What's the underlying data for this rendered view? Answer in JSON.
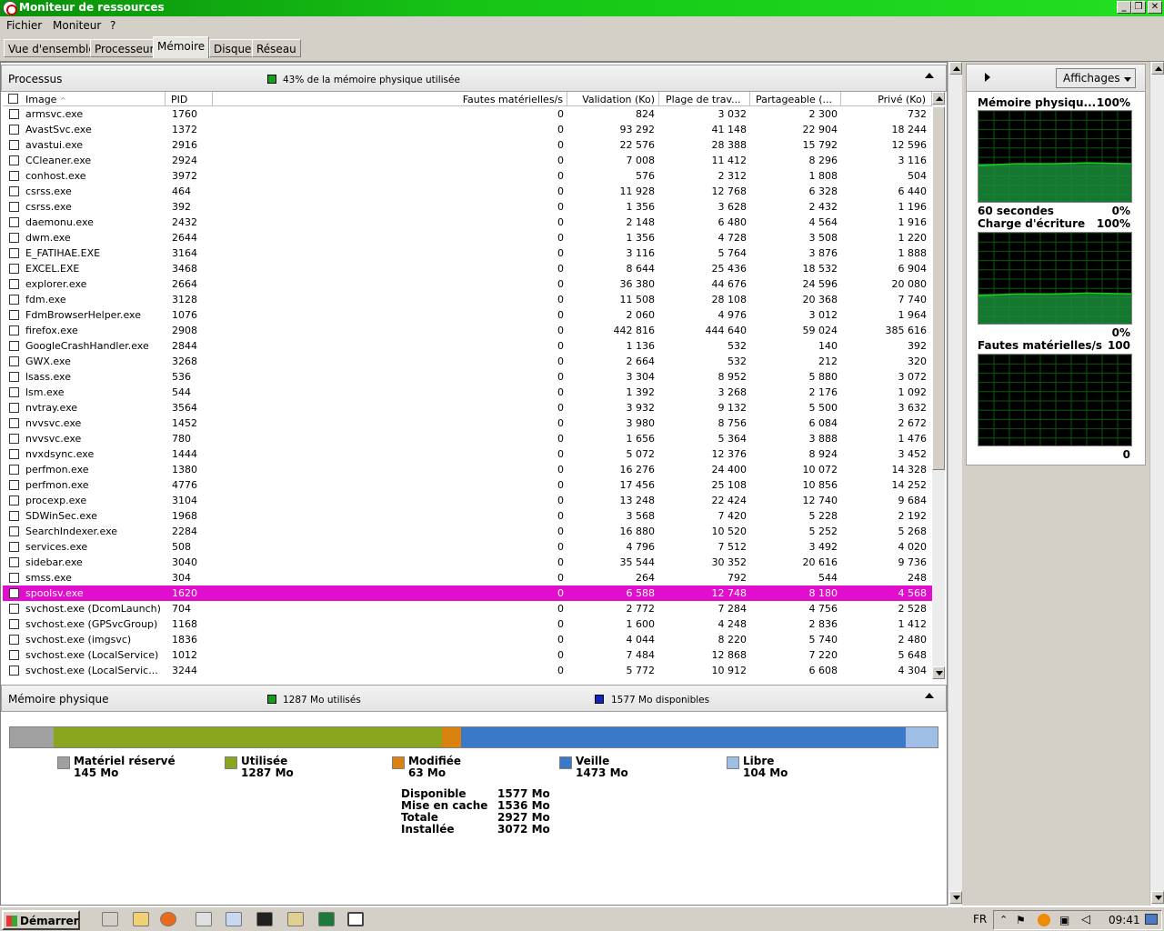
{
  "window": {
    "title": "Moniteur de ressources"
  },
  "menu": [
    "Fichier",
    "Moniteur",
    "?"
  ],
  "tabs": [
    "Vue d'ensemble",
    "Processeur",
    "Mémoire",
    "Disque",
    "Réseau"
  ],
  "active_tab": "Mémoire",
  "processes": {
    "title": "Processus",
    "info": "43% de la mémoire physique utilisée",
    "columns": [
      "Image",
      "PID",
      "Fautes matérielles/s",
      "Validation (Ko)",
      "Plage de trav...",
      "Partageable (...",
      "Privé (Ko)"
    ],
    "rows": [
      [
        "armsvc.exe",
        "1760",
        "0",
        "824",
        "3 032",
        "2 300",
        "732"
      ],
      [
        "AvastSvc.exe",
        "1372",
        "0",
        "93 292",
        "41 148",
        "22 904",
        "18 244"
      ],
      [
        "avastui.exe",
        "2916",
        "0",
        "22 576",
        "28 388",
        "15 792",
        "12 596"
      ],
      [
        "CCleaner.exe",
        "2924",
        "0",
        "7 008",
        "11 412",
        "8 296",
        "3 116"
      ],
      [
        "conhost.exe",
        "3972",
        "0",
        "576",
        "2 312",
        "1 808",
        "504"
      ],
      [
        "csrss.exe",
        "464",
        "0",
        "11 928",
        "12 768",
        "6 328",
        "6 440"
      ],
      [
        "csrss.exe",
        "392",
        "0",
        "1 356",
        "3 628",
        "2 432",
        "1 196"
      ],
      [
        "daemonu.exe",
        "2432",
        "0",
        "2 148",
        "6 480",
        "4 564",
        "1 916"
      ],
      [
        "dwm.exe",
        "2644",
        "0",
        "1 356",
        "4 728",
        "3 508",
        "1 220"
      ],
      [
        "E_FATIHAE.EXE",
        "3164",
        "0",
        "3 116",
        "5 764",
        "3 876",
        "1 888"
      ],
      [
        "EXCEL.EXE",
        "3468",
        "0",
        "8 644",
        "25 436",
        "18 532",
        "6 904"
      ],
      [
        "explorer.exe",
        "2664",
        "0",
        "36 380",
        "44 676",
        "24 596",
        "20 080"
      ],
      [
        "fdm.exe",
        "3128",
        "0",
        "11 508",
        "28 108",
        "20 368",
        "7 740"
      ],
      [
        "FdmBrowserHelper.exe",
        "1076",
        "0",
        "2 060",
        "4 976",
        "3 012",
        "1 964"
      ],
      [
        "firefox.exe",
        "2908",
        "0",
        "442 816",
        "444 640",
        "59 024",
        "385 616"
      ],
      [
        "GoogleCrashHandler.exe",
        "2844",
        "0",
        "1 136",
        "532",
        "140",
        "392"
      ],
      [
        "GWX.exe",
        "3268",
        "0",
        "2 664",
        "532",
        "212",
        "320"
      ],
      [
        "lsass.exe",
        "536",
        "0",
        "3 304",
        "8 952",
        "5 880",
        "3 072"
      ],
      [
        "lsm.exe",
        "544",
        "0",
        "1 392",
        "3 268",
        "2 176",
        "1 092"
      ],
      [
        "nvtray.exe",
        "3564",
        "0",
        "3 932",
        "9 132",
        "5 500",
        "3 632"
      ],
      [
        "nvvsvc.exe",
        "1452",
        "0",
        "3 980",
        "8 756",
        "6 084",
        "2 672"
      ],
      [
        "nvvsvc.exe",
        "780",
        "0",
        "1 656",
        "5 364",
        "3 888",
        "1 476"
      ],
      [
        "nvxdsync.exe",
        "1444",
        "0",
        "5 072",
        "12 376",
        "8 924",
        "3 452"
      ],
      [
        "perfmon.exe",
        "1380",
        "0",
        "16 276",
        "24 400",
        "10 072",
        "14 328"
      ],
      [
        "perfmon.exe",
        "4776",
        "0",
        "17 456",
        "25 108",
        "10 856",
        "14 252"
      ],
      [
        "procexp.exe",
        "3104",
        "0",
        "13 248",
        "22 424",
        "12 740",
        "9 684"
      ],
      [
        "SDWinSec.exe",
        "1968",
        "0",
        "3 568",
        "7 420",
        "5 228",
        "2 192"
      ],
      [
        "SearchIndexer.exe",
        "2284",
        "0",
        "16 880",
        "10 520",
        "5 252",
        "5 268"
      ],
      [
        "services.exe",
        "508",
        "0",
        "4 796",
        "7 512",
        "3 492",
        "4 020"
      ],
      [
        "sidebar.exe",
        "3040",
        "0",
        "35 544",
        "30 352",
        "20 616",
        "9 736"
      ],
      [
        "smss.exe",
        "304",
        "0",
        "264",
        "792",
        "544",
        "248"
      ],
      [
        "spoolsv.exe",
        "1620",
        "0",
        "6 588",
        "12 748",
        "8 180",
        "4 568"
      ],
      [
        "svchost.exe (DcomLaunch)",
        "704",
        "0",
        "2 772",
        "7 284",
        "4 756",
        "2 528"
      ],
      [
        "svchost.exe (GPSvcGroup)",
        "1168",
        "0",
        "1 600",
        "4 248",
        "2 836",
        "1 412"
      ],
      [
        "svchost.exe (imgsvc)",
        "1836",
        "0",
        "4 044",
        "8 220",
        "5 740",
        "2 480"
      ],
      [
        "svchost.exe (LocalService)",
        "1012",
        "0",
        "7 484",
        "12 868",
        "7 220",
        "5 648"
      ],
      [
        "svchost.exe (LocalServic...",
        "3244",
        "0",
        "5 772",
        "10 912",
        "6 608",
        "4 304"
      ]
    ],
    "selected_index": 31
  },
  "physical_memory": {
    "title": "Mémoire physique",
    "used_info": "1287 Mo utilisés",
    "available_info": "1577 Mo disponibles",
    "segments": [
      {
        "key": "reserved",
        "label": "Matériel réservé",
        "value": "145 Mo",
        "mb": 145,
        "color": "#a0a0a0"
      },
      {
        "key": "used",
        "label": "Utilisée",
        "value": "1287 Mo",
        "mb": 1287,
        "color": "#8aa61e"
      },
      {
        "key": "modified",
        "label": "Modifiée",
        "value": "63 Mo",
        "mb": 63,
        "color": "#d9820f"
      },
      {
        "key": "standby",
        "label": "Veille",
        "value": "1473 Mo",
        "mb": 1473,
        "color": "#3a78c8"
      },
      {
        "key": "free",
        "label": "Libre",
        "value": "104 Mo",
        "mb": 104,
        "color": "#9ebee6"
      }
    ],
    "totals": [
      {
        "k": "Disponible",
        "v": "1577 Mo"
      },
      {
        "k": "Mise en cache",
        "v": "1536 Mo"
      },
      {
        "k": "Totale",
        "v": "2927 Mo"
      },
      {
        "k": "Installée",
        "v": "3072 Mo"
      }
    ]
  },
  "right_panel": {
    "views_label": "Affichages",
    "graphs": [
      {
        "title": "Mémoire physiqu...",
        "max": "100%",
        "bottom_left": "60 secondes",
        "bottom_right": "0%",
        "level": 0.43
      },
      {
        "title": "Charge d'écriture",
        "max": "100%",
        "bottom_left": "",
        "bottom_right": "0%",
        "level": 0.34
      },
      {
        "title": "Fautes matérielles/s",
        "max": "100",
        "bottom_left": "",
        "bottom_right": "0",
        "level": 0.0
      }
    ]
  },
  "taskbar": {
    "start": "Démarrer",
    "lang": "FR",
    "time": "09:41"
  },
  "colors": {
    "selection": "#e20ecd",
    "graph_line": "#1ccf1c",
    "graph_fill": "#1a8c3a",
    "title_bar": "#16c416"
  }
}
